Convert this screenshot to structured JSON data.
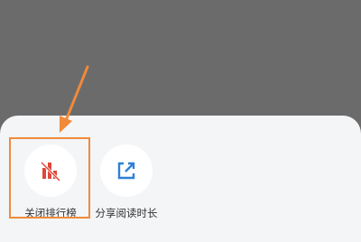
{
  "sheet": {
    "actions": [
      {
        "label": "关闭排行榜",
        "icon": "ranking-off-icon"
      },
      {
        "label": "分享阅读时长",
        "icon": "share-external-icon"
      }
    ]
  },
  "colors": {
    "overlay": "#6b6b6b",
    "sheet_bg": "#f4f5f7",
    "icon_red": "#e0473a",
    "icon_blue": "#2f7fd6",
    "annotation_orange": "#f08a3a"
  }
}
